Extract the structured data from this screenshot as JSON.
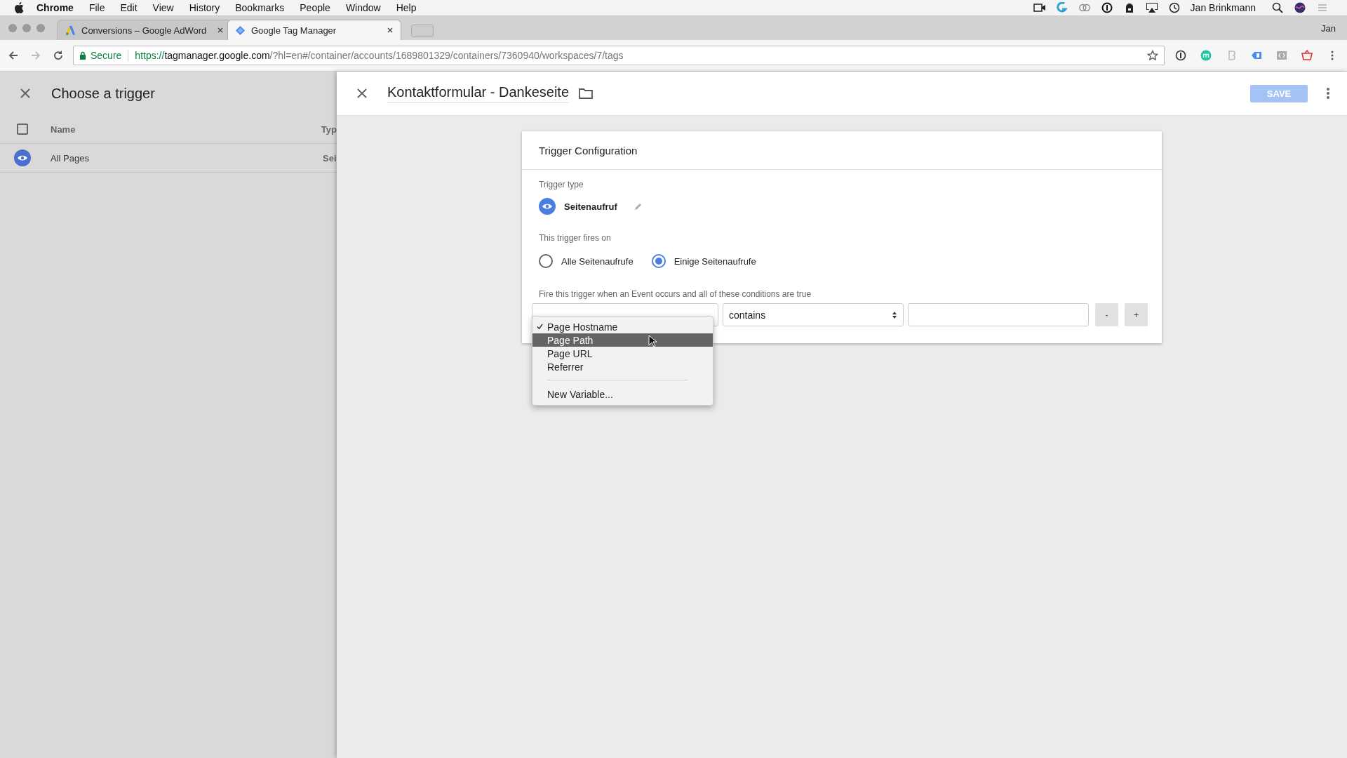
{
  "menu_bar": {
    "app": "Chrome",
    "items": [
      "File",
      "Edit",
      "View",
      "History",
      "Bookmarks",
      "People",
      "Window",
      "Help"
    ],
    "user": "Jan Brinkmann"
  },
  "browser": {
    "tabs": [
      {
        "title": "Conversions – Google AdWord",
        "kind": "ads",
        "selected": false
      },
      {
        "title": "Google Tag Manager",
        "kind": "gtm",
        "selected": true
      }
    ],
    "profile": "Jan",
    "address": {
      "secure": true,
      "secure_label": "Secure",
      "scheme": "https://",
      "host": "tagmanager.google.com",
      "path": "/?hl=en#/container/accounts/1689801329/containers/7360940/workspaces/7/tags"
    }
  },
  "trigger_list": {
    "title": "Choose a trigger",
    "select_all": {
      "checked": false
    },
    "columns": [
      "Name",
      "Typ"
    ],
    "rows": [
      {
        "name": "All Pages",
        "type": "Sei"
      }
    ]
  },
  "editor": {
    "title": "Kontaktformular - Dankeseite",
    "save": {
      "label": "SAVE",
      "disabled": true
    },
    "card": {
      "title": "Trigger Configuration",
      "type_label": "Trigger type",
      "type_name": "Seitenaufruf",
      "fires_on_label": "This trigger fires on",
      "fires_on": [
        {
          "label": "Alle Seitenaufrufe",
          "selected": false
        },
        {
          "label": "Einige Seitenaufrufe",
          "selected": true
        }
      ],
      "conditions_label": "Fire this trigger when an Event occurs and all of these conditions are true",
      "condition": {
        "operator": "contains",
        "remove": "-",
        "add": "+"
      },
      "variable_menu": [
        {
          "kind": "option",
          "label": "Page Hostname",
          "checked": true,
          "selected": false
        },
        {
          "kind": "option",
          "label": "Page Path",
          "checked": false,
          "selected": true
        },
        {
          "kind": "option",
          "label": "Page URL",
          "checked": false,
          "selected": false
        },
        {
          "kind": "option",
          "label": "Referrer",
          "checked": false,
          "selected": false
        },
        {
          "kind": "separator"
        },
        {
          "kind": "option",
          "label": "New Variable...",
          "checked": false,
          "selected": false
        }
      ]
    }
  }
}
